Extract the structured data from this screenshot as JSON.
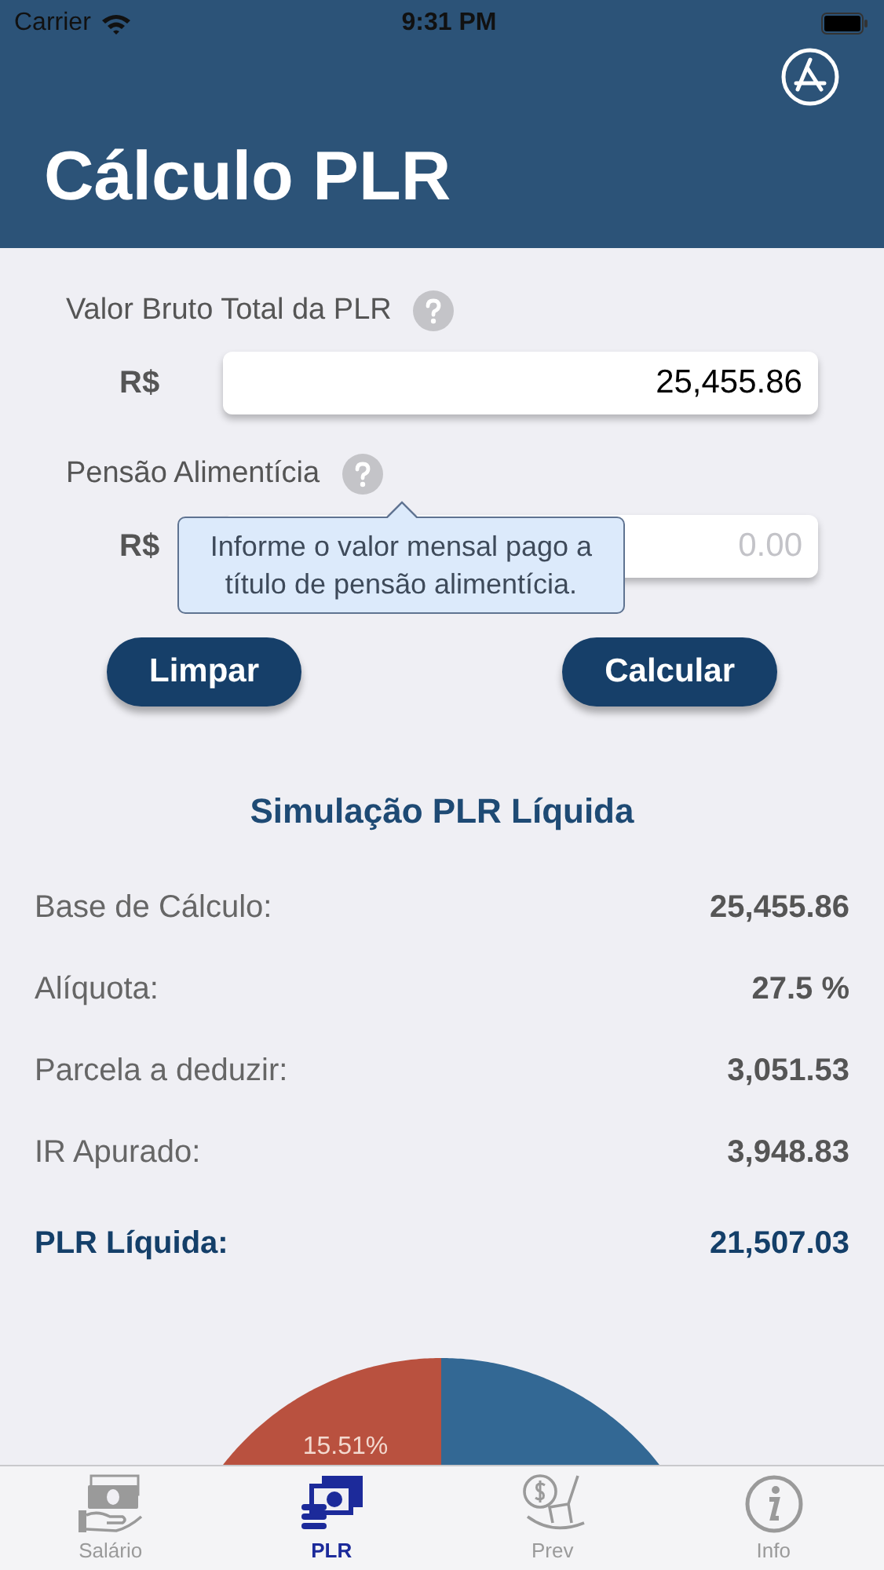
{
  "status_bar": {
    "carrier": "Carrier",
    "time": "9:31 PM"
  },
  "header": {
    "title": "Cálculo PLR"
  },
  "fields": [
    {
      "label": "Valor Bruto Total da PLR",
      "currency": "R$",
      "value": "25,455.86"
    },
    {
      "label": "Pensão Alimentícia",
      "currency": "R$",
      "placeholder": "0.00"
    }
  ],
  "tooltip": {
    "text": "Informe o valor mensal pago a título de pensão alimentícia."
  },
  "buttons": [
    "Limpar",
    "Calcular"
  ],
  "summary": {
    "title": "Simulação PLR Líquida",
    "rows": [
      {
        "label": "Base de Cálculo:",
        "value": "25,455.86",
        "kind": "normal"
      },
      {
        "label": "Alíquota:",
        "value": "27.5 %",
        "kind": "normal"
      },
      {
        "label": "Parcela a deduzir:",
        "value": "3,051.53",
        "kind": "normal"
      },
      {
        "label": "IR Apurado:",
        "value": "3,948.83",
        "kind": "normal"
      },
      {
        "label": "PLR Líquida:",
        "value": "21,507.03",
        "kind": "total"
      }
    ]
  },
  "pie": {
    "kind": "picture",
    "label": "15.51%"
  },
  "tab_bar": [
    {
      "label": "Salário",
      "selected": false
    },
    {
      "label": "PLR",
      "selected": true
    },
    {
      "label": "Prev",
      "selected": false
    },
    {
      "label": "Info",
      "selected": false
    }
  ]
}
